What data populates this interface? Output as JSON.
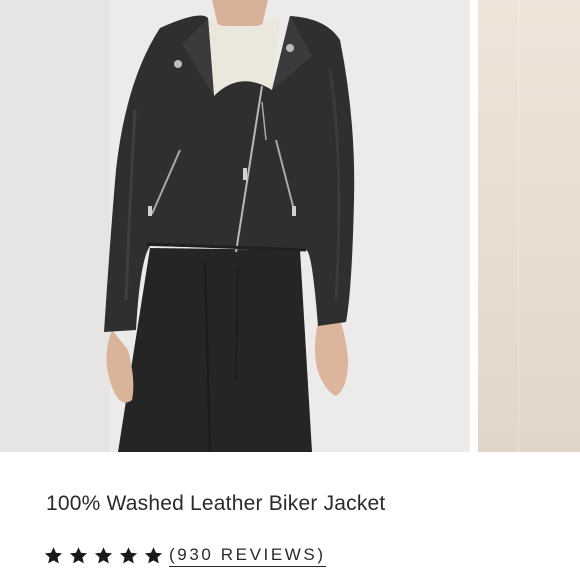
{
  "gallery": {
    "images": [
      {
        "alt": "",
        "icon": "product-photo-leather-jacket"
      },
      {
        "alt": "",
        "icon": "product-photo-next"
      }
    ]
  },
  "product": {
    "title": "100% Washed Leather Biker Jacket",
    "rating": {
      "stars": 5,
      "max_stars": 5,
      "star_color": "#1a1a1a",
      "reviews_text": "(930 REVIEWS)"
    }
  },
  "colors": {
    "text": "#2a2a2a",
    "photo_background": "#ecebea",
    "jacket": "#2e2f2e",
    "trousers": "#262525"
  }
}
